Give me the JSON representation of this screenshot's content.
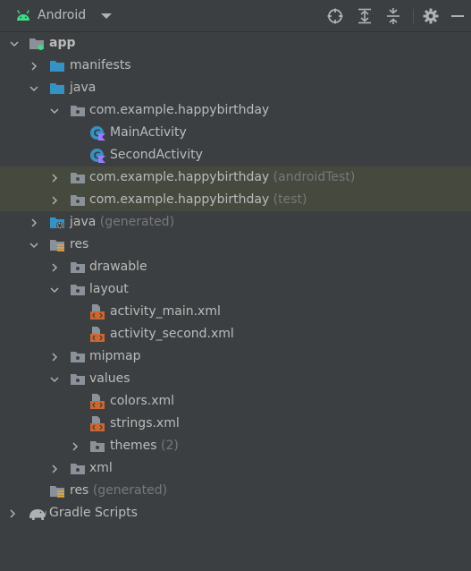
{
  "toolbar": {
    "view_label": "Android",
    "icons": [
      "android-icon",
      "dropdown-arrow-icon",
      "locate-icon",
      "expand-all-icon",
      "collapse-all-icon",
      "gear-icon",
      "hide-icon"
    ]
  },
  "tree": {
    "app": "app",
    "manifests": "manifests",
    "java": "java",
    "pkg_main": "com.example.happybirthday",
    "main_activity": "MainActivity",
    "second_activity": "SecondActivity",
    "pkg_android_test": "com.example.happybirthday",
    "pkg_android_test_hint": "(androidTest)",
    "pkg_test": "com.example.happybirthday",
    "pkg_test_hint": "(test)",
    "java_generated": "java",
    "java_generated_hint": "(generated)",
    "res": "res",
    "drawable": "drawable",
    "layout": "layout",
    "activity_main": "activity_main.xml",
    "activity_second": "activity_second.xml",
    "mipmap": "mipmap",
    "values": "values",
    "colors": "colors.xml",
    "strings": "strings.xml",
    "themes": "themes",
    "themes_hint": "(2)",
    "xml": "xml",
    "res_generated": "res",
    "res_generated_hint": "(generated)",
    "gradle_scripts": "Gradle Scripts"
  },
  "colors": {
    "background": "#3c3f41",
    "highlight_row": "#45493e",
    "text": "#bbbbbb",
    "hint_text": "#787878",
    "folder_blue": "#3592c4",
    "folder_gray": "#8a9199",
    "android_green": "#3ddc84",
    "xml_orange": "#cc6633"
  }
}
